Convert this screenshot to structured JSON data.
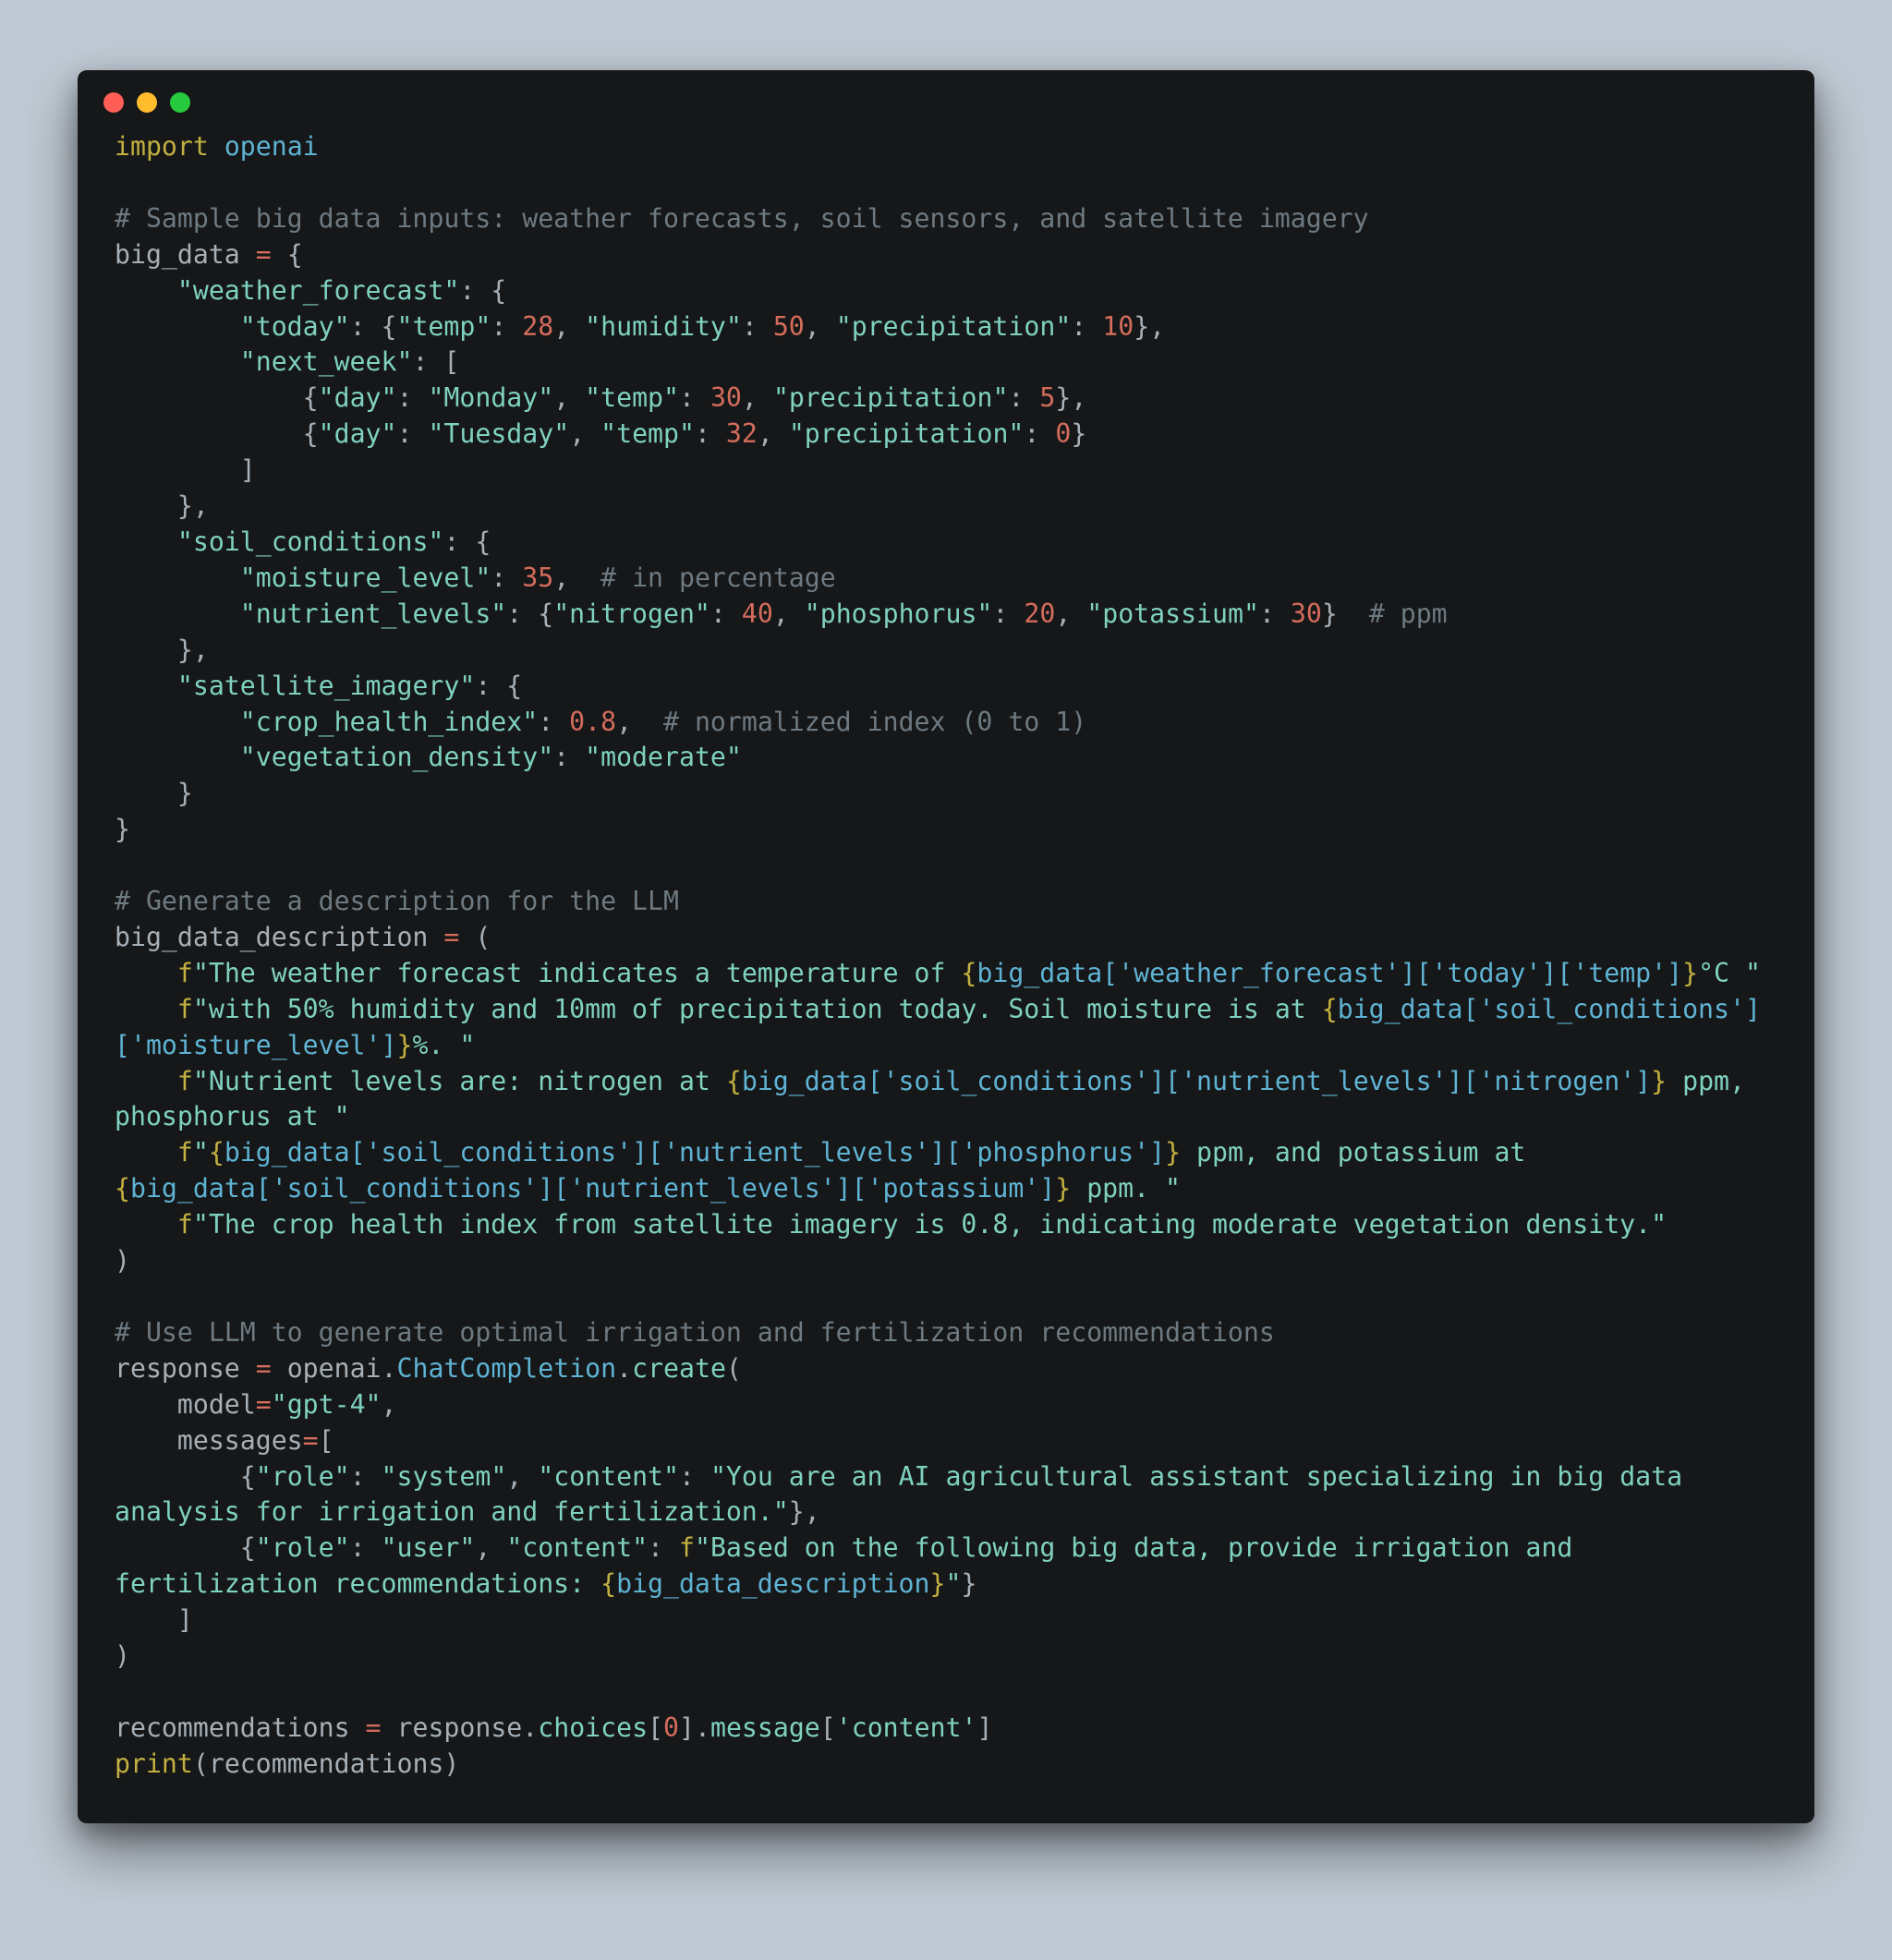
{
  "code": {
    "line_empty": "",
    "import_kw": "import",
    "import_mod": "openai",
    "c_bigdata": "# Sample big data inputs: weather forecasts, soil sensors, and satellite imagery",
    "bigdata_decl_name": "big_data ",
    "eq": "=",
    "open_brace": " {",
    "wf_key": "\"weather_forecast\"",
    "today_key": "\"today\"",
    "temp_key": "\"temp\"",
    "hum_key": "\"humidity\"",
    "precip_key": "\"precipitation\"",
    "n28": "28",
    "n50": "50",
    "n10": "10",
    "nextweek_key": "\"next_week\"",
    "day_key": "\"day\"",
    "mon": "\"Monday\"",
    "tue": "\"Tuesday\"",
    "n30": "30",
    "n5": "5",
    "n32": "32",
    "n0": "0",
    "soil_key": "\"soil_conditions\"",
    "moist_key": "\"moisture_level\"",
    "n35": "35",
    "c_pct": "# in percentage",
    "nutr_key": "\"nutrient_levels\"",
    "nitro_key": "\"nitrogen\"",
    "phos_key": "\"phosphorus\"",
    "pot_key": "\"potassium\"",
    "n40": "40",
    "n20": "20",
    "n30b": "30",
    "c_ppm": "# ppm",
    "sat_key": "\"satellite_imagery\"",
    "chi_key": "\"crop_health_index\"",
    "n08": "0.8",
    "c_norm": "# normalized index (0 to 1)",
    "veg_key": "\"vegetation_density\"",
    "veg_val": "\"moderate\"",
    "c_desc": "# Generate a description for the LLM",
    "desc_name": "big_data_description ",
    "f": "f",
    "d1": "\"The weather forecast indicates a temperature of ",
    "i1": "big_data['weather_forecast']['today']['temp']",
    "d1b": "°C \"",
    "d2": "\"with 50% humidity and 10mm of precipitation today. Soil moisture is at ",
    "i2": "big_data['soil_conditions']['moisture_level']",
    "d2b": "%. \"",
    "d3": "\"Nutrient levels are: nitrogen at ",
    "i3": "big_data['soil_conditions']['nutrient_levels']['nitrogen']",
    "d3b": " ppm, phosphorus at \"",
    "d4a": "\"",
    "i4": "big_data['soil_conditions']['nutrient_levels']['phosphorus']",
    "d4b": " ppm, and potassium at ",
    "i5": "big_data['soil_conditions']['nutrient_levels']['potassium']",
    "d4c": " ppm. \"",
    "d5": "\"The crop health index from satellite imagery is 0.8, indicating moderate vegetation density.\"",
    "c_llm": "# Use LLM to generate optimal irrigation and fertilization recommendations",
    "resp": "response ",
    "openai": "openai",
    "cc": "ChatCompletion",
    "create": "create",
    "model_kw": "model",
    "model_val": "\"gpt-4\"",
    "msgs_kw": "messages",
    "role_key": "\"role\"",
    "content_key": "\"content\"",
    "sys": "\"system\"",
    "sys_content": "\"You are an AI agricultural assistant specializing in big data analysis for irrigation and fertilization.\"",
    "user": "\"user\"",
    "user_pref": "\"Based on the following big data, provide irrigation and fertilization recommendations: ",
    "user_int": "big_data_description",
    "user_suf": "\"",
    "recs": "recommendations ",
    "resp2": "response",
    "choices": "choices",
    "msg": "message",
    "contentq": "'content'",
    "print": "print",
    "recs2": "recommendations",
    "lbr": "{",
    "rbr": "}"
  }
}
